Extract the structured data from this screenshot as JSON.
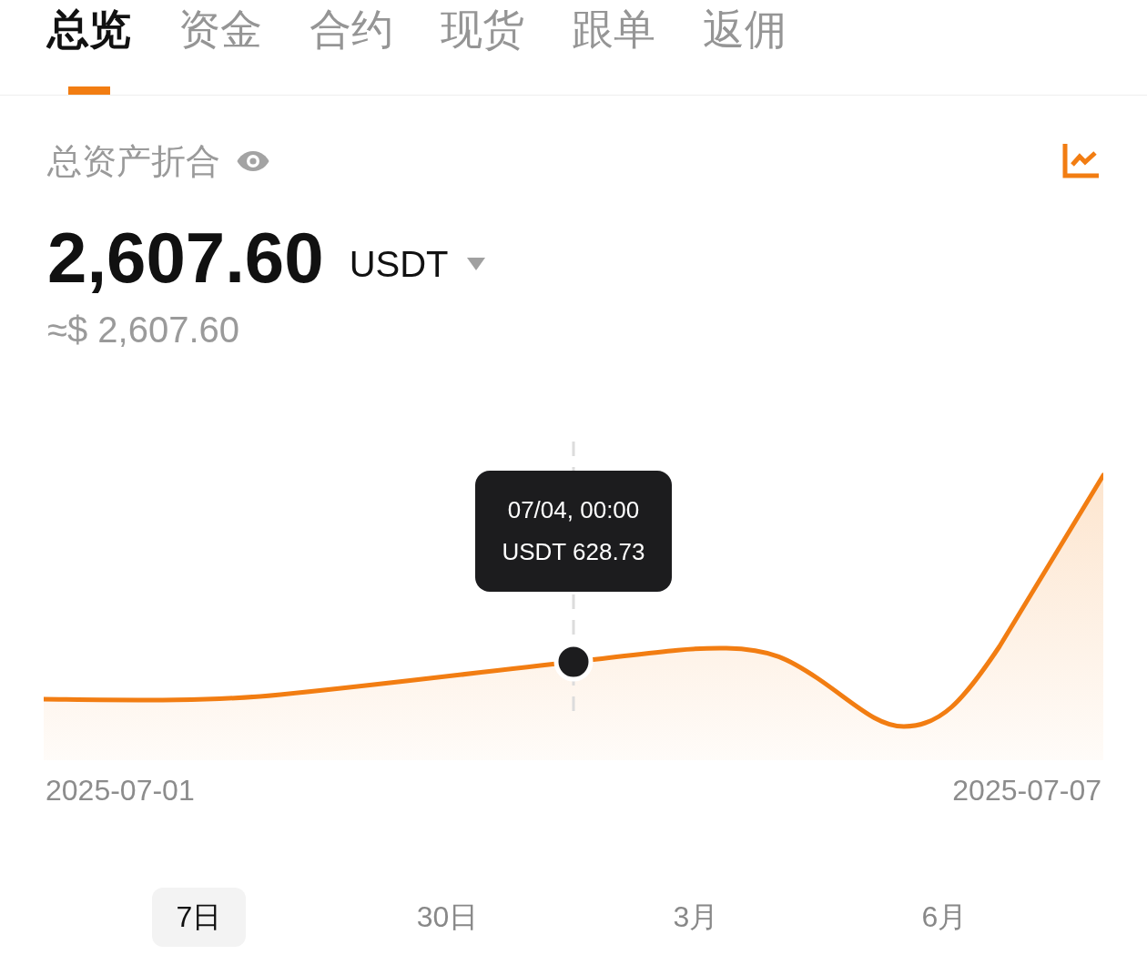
{
  "tabs": [
    {
      "label": "总览",
      "selected": true
    },
    {
      "label": "资金",
      "selected": false
    },
    {
      "label": "合约",
      "selected": false
    },
    {
      "label": "现货",
      "selected": false
    },
    {
      "label": "跟单",
      "selected": false
    },
    {
      "label": "返佣",
      "selected": false
    }
  ],
  "summary": {
    "title": "总资产折合",
    "amount": "2,607.60",
    "currency": "USDT",
    "approx": "≈$ 2,607.60"
  },
  "chart": {
    "tooltip": {
      "time": "07/04, 00:00",
      "value": "USDT 628.73"
    },
    "start_label": "2025-07-01",
    "end_label": "2025-07-07"
  },
  "periods": [
    {
      "label": "7日",
      "selected": true
    },
    {
      "label": "30日",
      "selected": false
    },
    {
      "label": "3月",
      "selected": false
    },
    {
      "label": "6月",
      "selected": false
    }
  ]
}
